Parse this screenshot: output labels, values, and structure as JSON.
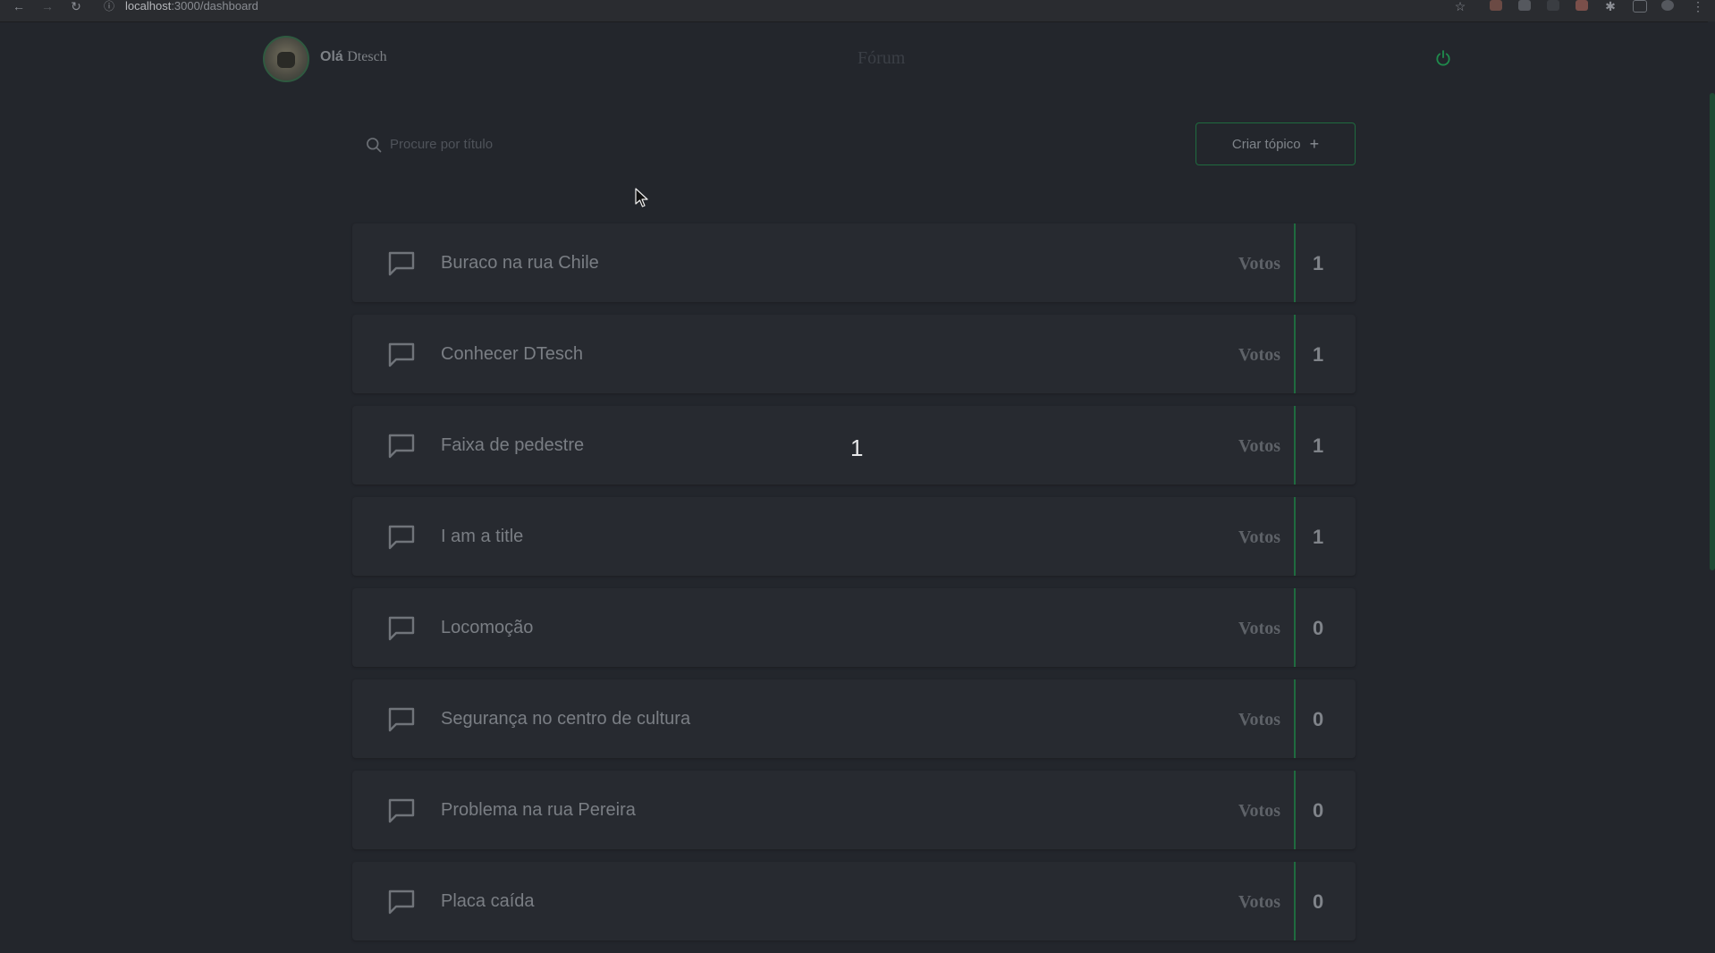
{
  "browser": {
    "url_host": "localhost",
    "url_path": ":3000/dashboard"
  },
  "header": {
    "greeting_hello": "Olá",
    "greeting_name": "Dtesch",
    "title": "Fórum"
  },
  "search": {
    "placeholder": "Procure por título",
    "value": ""
  },
  "actions": {
    "create_label": "Criar tópico",
    "create_icon": "+"
  },
  "overlay": {
    "number": "1"
  },
  "topics": [
    {
      "title": "Buraco na rua Chile",
      "votes_label": "Votos",
      "votes": "1"
    },
    {
      "title": "Conhecer DTesch",
      "votes_label": "Votos",
      "votes": "1"
    },
    {
      "title": "Faixa de pedestre",
      "votes_label": "Votos",
      "votes": "1"
    },
    {
      "title": "I am a title",
      "votes_label": "Votos",
      "votes": "1"
    },
    {
      "title": "Locomoção",
      "votes_label": "Votos",
      "votes": "0"
    },
    {
      "title": "Segurança no centro de cultura",
      "votes_label": "Votos",
      "votes": "0"
    },
    {
      "title": "Problema na rua Pereira",
      "votes_label": "Votos",
      "votes": "0"
    },
    {
      "title": "Placa caída",
      "votes_label": "Votos",
      "votes": "0"
    }
  ],
  "colors": {
    "background": "#23262c",
    "card": "#272a30",
    "accent": "#1f6b3f",
    "power_icon": "#1f8a4c"
  }
}
